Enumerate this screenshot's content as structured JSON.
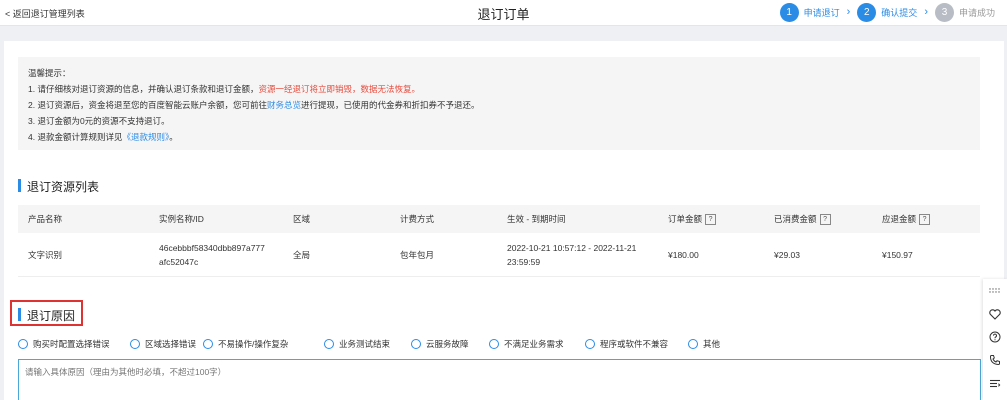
{
  "header": {
    "back_label": "< 返回退订管理列表",
    "title": "退订订单",
    "steps": [
      {
        "number": "1",
        "label": "申请退订",
        "state": "active"
      },
      {
        "number": "2",
        "label": "确认提交",
        "state": "active"
      },
      {
        "number": "3",
        "label": "申请成功",
        "state": "inactive"
      }
    ]
  },
  "notice": {
    "heading": "温馨提示：",
    "line1_prefix": "1. 请仔细核对退订资源的信息，并确认退订条款和退订金额，",
    "line1_red": "资源一经退订将立即销毁，数据无法恢复。",
    "line2_prefix": "2. 退订资源后，资金将退至您的百度智能云账户余额，您可前往",
    "line2_link": "财务总览",
    "line2_suffix": "进行提现，已使用的代金券和折扣券不予退还。",
    "line3": "3. 退订金额为0元的资源不支持退订。",
    "line4_prefix": "4. 退款金额计算规则详见",
    "line4_link": "《退款规则》",
    "line4_suffix": "。"
  },
  "resource_section": {
    "title": "退订资源列表",
    "columns": [
      "产品名称",
      "实例名称/ID",
      "区域",
      "计费方式",
      "生效 - 到期时间",
      "订单金额",
      "已消费金额",
      "应退金额"
    ],
    "help_mark": "?",
    "row": {
      "product": "文字识别",
      "instance_line1": "46cebbbf58340dbb897a777",
      "instance_line2": "afc52047c",
      "region": "全局",
      "billing": "包年包月",
      "period_line1": "2022-10-21 10:57:12 - 2022-11-21",
      "period_line2": "23:59:59",
      "order_amount": "¥180.00",
      "consumed_amount": "¥29.03",
      "refund_amount": "¥150.97"
    }
  },
  "reason_section": {
    "title": "退订原因",
    "options": [
      "购买时配置选择错误",
      "区域选择错误",
      "不易操作/操作复杂",
      "业务测试结束",
      "云服务故障",
      "不满足业务需求",
      "程序或软件不兼容",
      "其他"
    ],
    "textarea_placeholder": "请输入具体原因（理由为其他时必填，不超过100字）"
  },
  "tools": [
    "grip-icon",
    "heart-icon",
    "help-icon",
    "phone-icon",
    "list-icon"
  ],
  "colors": {
    "accent": "#2b8ce6",
    "warning_text": "#e84a3c",
    "step_inactive": "#b8bcc4",
    "highlight_box": "#dd3333"
  }
}
